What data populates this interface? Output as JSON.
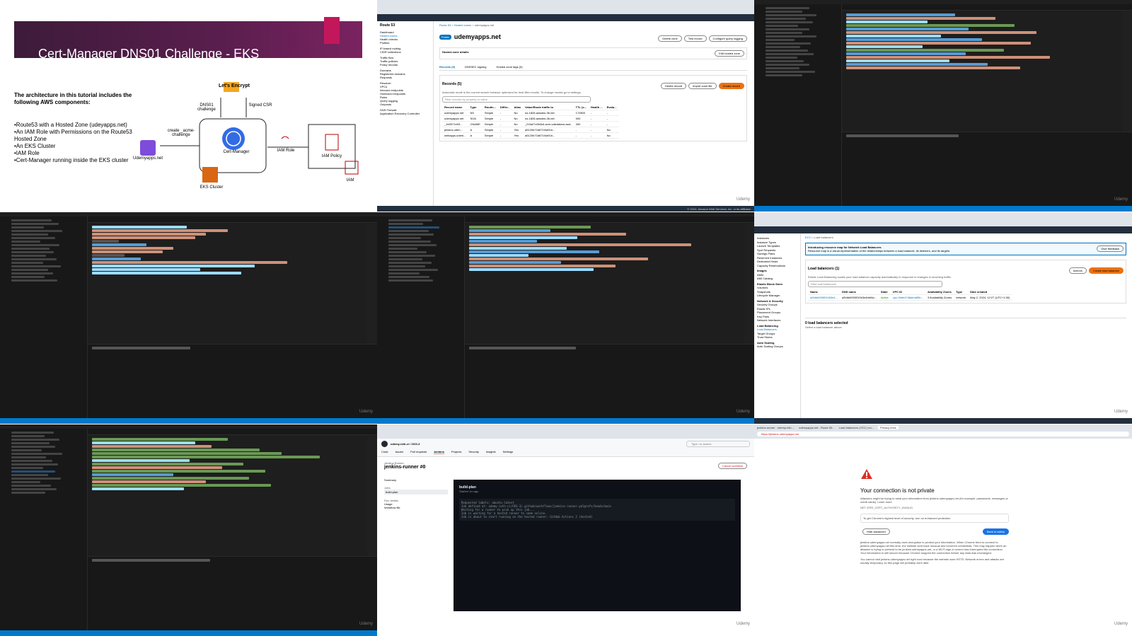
{
  "slide": {
    "title": "Cert-Manager DNS01 Challenge - EKS",
    "intro": "The architecture in this tutorial includes the following AWS components:",
    "bullets": [
      "•Route53 with a Hosted Zone (udeyapps.net)",
      "•An IAM Role with Permissions on the Route53 Hosted Zone",
      "•An EKS Cluster",
      "•IAM Role",
      "•Cert-Manager running inside the EKS cluster"
    ],
    "labels": {
      "lets_encrypt": "Let's Encrypt",
      "dns01": "DNS01 challenge",
      "signed_csr": "Signed CSR",
      "create_acme": "create _acme-challenge",
      "cert_manager": "Cert-Manager",
      "iam_role": "IAM Role",
      "iam_policy": "IAM Policy",
      "udemyapps": "Udemyapps.net",
      "eks_cluster": "EKS Cluster",
      "iam": "IAM"
    }
  },
  "route53": {
    "sidebar_title": "Route 53",
    "sidebar_items": [
      "Dashboard",
      "Hosted zones",
      "Health checks",
      "Profiles",
      "IP-based routing",
      "CIDR collections",
      "Traffic flow",
      "Traffic policies",
      "Policy records",
      "Domains",
      "Registered domains",
      "Requests",
      "Resolver",
      "VPCs",
      "Inbound endpoints",
      "Outbound endpoints",
      "Rules",
      "Query logging",
      "Outposts",
      "DNS Firewall",
      "Application Recovery Controller"
    ],
    "breadcrumb": [
      "Route 53",
      "Hosted zones",
      "udemyapps.net"
    ],
    "zone_badge": "Public",
    "zone_name": "udemyapps.net",
    "buttons": [
      "Delete zone",
      "Test record",
      "Configure query logging"
    ],
    "details_label": "Hosted zone details",
    "edit_button": "Edit hosted zone",
    "tabs": [
      "Records (5)",
      "DNSSEC signing",
      "Hosted zone tags (0)"
    ],
    "records_title": "Records (5)",
    "records_hint": "Automatic mode is the current search behavior optimized for best filter results. To change modes go to settings.",
    "filter_placeholder": "Filter records by property or value",
    "record_buttons": [
      "Delete record",
      "Import zone file",
      "Create record"
    ],
    "columns": [
      "Record name",
      "Type",
      "Routin...",
      "Differ...",
      "Alias",
      "Value/Route traffic to",
      "TTL (s...",
      "Health ...",
      "Evalu..."
    ],
    "rows": [
      [
        "udemyapps.net",
        "NS",
        "Simple",
        "-",
        "No",
        "ns-1828.awsdns-36.net.",
        "172800",
        "-",
        "-"
      ],
      [
        "udemyapps.net",
        "SOA",
        "Simple",
        "-",
        "No",
        "ns-1828.awsdns-36.net.",
        "900",
        "-",
        "-"
      ],
      [
        "_1b0971e93...",
        "CNAME",
        "Simple",
        "-",
        "No",
        "_f19a27c5b3c6.acm-validations.aws.",
        "300",
        "-",
        "-"
      ],
      [
        "jenkins.uden...",
        "A",
        "Simple",
        "-",
        "Yes",
        "a5120b72d671f4d91b...",
        "-",
        "-",
        "No"
      ],
      [
        "webapps.udem...",
        "A",
        "Simple",
        "-",
        "Yes",
        "a5120b72d671f4d91b...",
        "-",
        "-",
        "No"
      ]
    ],
    "footer": "© 2024, Amazon Web Services, Inc. or its affiliates."
  },
  "ec2": {
    "sidebar_items": [
      "Instances",
      "Instance Types",
      "Launch Templates",
      "Spot Requests",
      "Savings Plans",
      "Reserved Instances",
      "Dedicated Hosts",
      "Capacity Reservations",
      "Images",
      "AMIs",
      "AMI Catalog",
      "Elastic Block Store",
      "Volumes",
      "Snapshots",
      "Lifecycle Manager",
      "Network & Security",
      "Security Groups",
      "Elastic IPs",
      "Placement Groups",
      "Key Pairs",
      "Network Interfaces",
      "Load Balancing",
      "Load Balancers",
      "Target Groups",
      "Trust Stores",
      "Auto Scaling",
      "Auto Scaling Groups"
    ],
    "breadcrumb": [
      "EC2",
      "Load balancers"
    ],
    "banner_title": "Introducing resource map for Network Load Balancers",
    "banner_text": "Resource map is a visual representation of the relationships between a load balancer, its listeners, and its targets.",
    "feedback": "Give feedback",
    "lb_title": "Load balancers (1)",
    "lb_sub": "Elastic Load Balancing scales your load balancer capacity automatically in response to changes in incoming traffic.",
    "actions": "Actions",
    "create_lb": "Create load balancer",
    "filter_placeholder": "Filter load balancers",
    "columns": [
      "Name",
      "DNS name",
      "State",
      "VPC ID",
      "Availability Zones",
      "Type",
      "Date created"
    ],
    "row": [
      "a2b6b005f2f10b3e4...",
      "a2b6b005f2f10b3e4bbf4a...",
      "Active",
      "vpc-0b6e47d8ab4df5b...",
      "3 Availability Zones",
      "network",
      "May 2, 2024, 12:27 (UTC+1:00)"
    ],
    "selected": "0 load balancers selected",
    "select_hint": "Select a load balancer above."
  },
  "github": {
    "repo": "udemy-ivth-ci / CKS-3",
    "tabs": [
      "Code",
      "Issues",
      "Pull requests",
      "Actions",
      "Projects",
      "Security",
      "Insights",
      "Settings"
    ],
    "search": "Type / to search",
    "workflow_back": "Jenkins Runner",
    "run_title": "jenkins-runner #0",
    "cancel": "Cancel workflow",
    "summary": "Summary",
    "jobs_label": "Jobs",
    "job": "build-plan",
    "run_details": "Run details",
    "usage": "Usage",
    "workflow_file": "Workflow file",
    "log_title": "build-plan",
    "log_sub": "Started 1m ago",
    "log_lines": [
      "Requested labels: ubuntu-latest",
      "Job defined at: udemy-ivth-ci/CKS-3/.github/workflows/jenkins-runner.yml@refs/heads/main",
      "Waiting for a runner to pick up this job...",
      "Job is waiting for a hosted runner to come online.",
      "Job is about to start running on the hosted runner: GitHub Actions 2 (hosted)"
    ]
  },
  "privacy": {
    "url": "https://jenkins.udemyapps.net",
    "tabs": [
      "jenkins-runner · udemy-ivth-...",
      "udemyapps.net - Route 53...",
      "Load balancers | EC2 | eu...",
      "Privacy error"
    ],
    "title": "Your connection is not private",
    "body": "Attackers might be trying to steal your information from jenkins.udemyapps.net (for example, passwords, messages or credit cards). Learn more",
    "code": "NET::ERR_CERT_AUTHORITY_INVALID",
    "protection": "To get Chrome's highest level of security, turn on enhanced protection",
    "hide_btn": "Hide advanced",
    "back_btn": "Back to safety",
    "detail1": "jenkins.udemyapps.net normally uses encryption to protect your information. When Chrome tried to connect to jenkins.udemyapps.net this time, the website sent back unusual and incorrect credentials. This may happen when an attacker is trying to pretend to be jenkins.udemyapps.net, or a Wi-Fi sign-in screen has interrupted the connection. Your information is still secure because Chrome stopped the connection before any data was exchanged.",
    "detail2": "You cannot visit jenkins.udemyapps.net right now because the website uses HSTS. Network errors and attacks are usually temporary, so this page will probably work later."
  },
  "watermark": "Udemy"
}
